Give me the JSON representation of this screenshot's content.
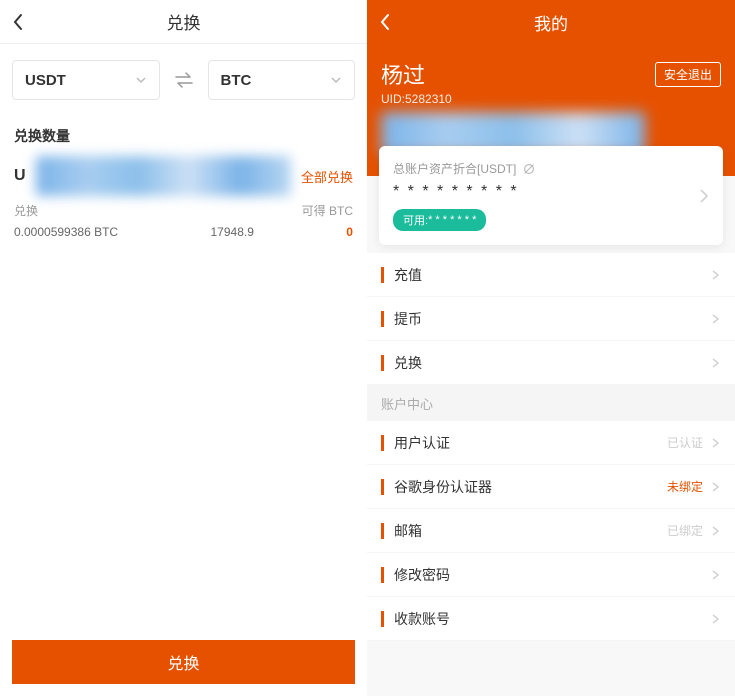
{
  "left": {
    "title": "兑换",
    "from_currency": "USDT",
    "to_currency": "BTC",
    "amount_section_label": "兑换数量",
    "amount_prefix": "U",
    "all_exchange_label": "全部兑换",
    "exchange_small_label": "兑换",
    "available_label": "可得 BTC",
    "rate_value": "0.0000599386 BTC",
    "rate_mid": "17948.9",
    "rate_right": "0",
    "submit_label": "兑换"
  },
  "right": {
    "title": "我的",
    "username": "杨过",
    "uid_label": "UID:5282310",
    "logout_label": "安全退出",
    "asset_label": "总账户资产折合[USDT]",
    "asset_value": "* * * * * * * * *",
    "available_label": "可用:",
    "available_value": "* * * * * * *",
    "menu_actions": [
      {
        "label": "充值"
      },
      {
        "label": "提币"
      },
      {
        "label": "兑换"
      }
    ],
    "account_center_label": "账户中心",
    "menu_account": [
      {
        "label": "用户认证",
        "status": "已认证",
        "warn": false
      },
      {
        "label": "谷歌身份认证器",
        "status": "未绑定",
        "warn": true
      },
      {
        "label": "邮箱",
        "status": "已绑定",
        "warn": false
      },
      {
        "label": "修改密码",
        "status": "",
        "warn": false
      },
      {
        "label": "收款账号",
        "status": "",
        "warn": false
      }
    ]
  }
}
